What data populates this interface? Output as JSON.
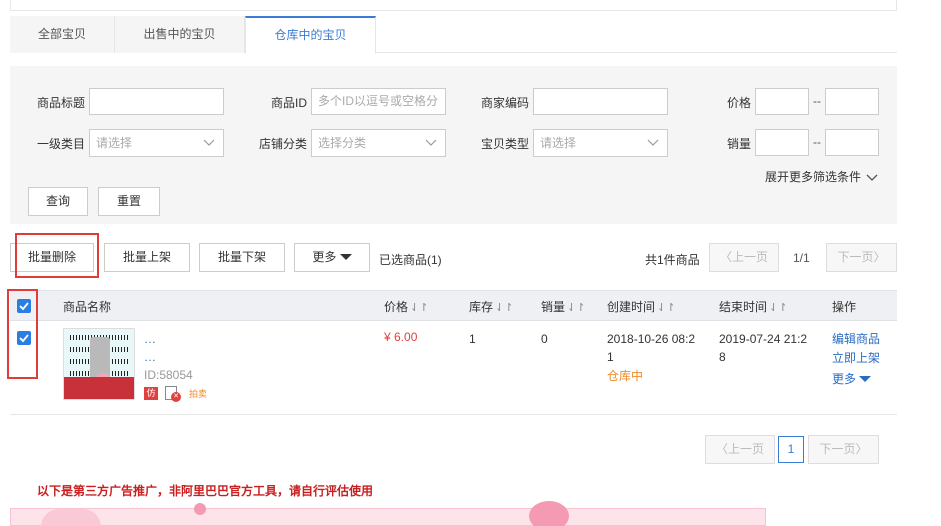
{
  "tabs": [
    "全部宝贝",
    "出售中的宝贝",
    "仓库中的宝贝"
  ],
  "filter": {
    "title_label": "商品标题",
    "id_label": "商品ID",
    "id_placeholder": "多个ID以逗号或空格分",
    "code_label": "商家编码",
    "price_label": "价格",
    "category_label": "一级类目",
    "category_value": "请选择",
    "shop_cat_label": "店铺分类",
    "shop_cat_value": "选择分类",
    "type_label": "宝贝类型",
    "type_value": "请选择",
    "sales_label": "销量",
    "range_sep": "--",
    "more": "展开更多筛选条件",
    "query_btn": "查询",
    "reset_btn": "重置"
  },
  "actions": {
    "batch_delete": "批量删除",
    "batch_on": "批量上架",
    "batch_off": "批量下架",
    "more": "更多",
    "selected": "已选商品(1)",
    "total": "共1件商品",
    "prev": "上一页",
    "next": "下一页",
    "page": "1/1"
  },
  "table": {
    "headers": {
      "name": "商品名称",
      "price": "价格",
      "stock": "库存",
      "sales": "销量",
      "created": "创建时间",
      "end": "结束时间",
      "ops": "操作"
    },
    "rows": [
      {
        "name": "…",
        "name_line2": "…",
        "id": "ID:58054",
        "tag_fang": "仿",
        "tag_paimai": "拍卖",
        "price": "¥ 6.00",
        "stock": "1",
        "sales": "0",
        "created_line1": "2018-10-26 08:2",
        "created_line2": "1",
        "status": "仓库中",
        "end_line1": "2019-07-24 21:2",
        "end_line2": "8",
        "op_edit": "编辑商品",
        "op_list": "立即上架",
        "op_more": "更多"
      }
    ]
  },
  "bottom_pager": {
    "prev": "上一页",
    "page": "1",
    "next": "下一页"
  },
  "ad_note": "以下是第三方广告推广，非阿里巴巴官方工具，请自行评估使用",
  "colors": {
    "accent": "#3a7bd5",
    "price": "#e0413f",
    "status": "#f08a2b",
    "highlight": "#e23b3b"
  }
}
